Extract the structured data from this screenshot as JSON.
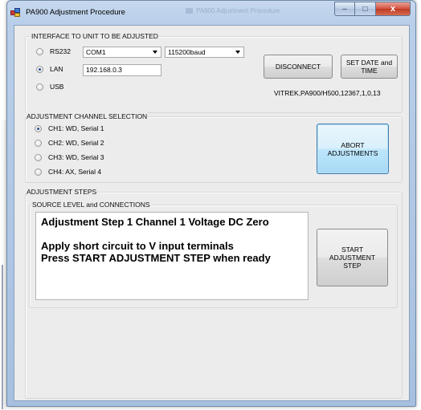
{
  "window": {
    "title": "PA900 Adjustment Procedure",
    "ghost_title": "PA900 Adjustment Procedure",
    "controls": {
      "minimize": "–",
      "maximize": "□",
      "close": "x"
    }
  },
  "interface_group": {
    "legend": "INTERFACE TO UNIT TO BE ADJUSTED",
    "options": [
      {
        "label": "RS232",
        "checked": false
      },
      {
        "label": "LAN",
        "checked": true
      },
      {
        "label": "USB",
        "checked": false
      }
    ],
    "com_port": {
      "value": "COM1"
    },
    "baud_rate": {
      "value": "115200baud"
    },
    "ip_address": {
      "value": "192.168.0.3"
    },
    "disconnect_label": "DISCONNECT",
    "set_date_label_line1": "SET DATE and",
    "set_date_label_line2": "TIME",
    "device_id": "VITREK,PA900/H500,12367,1,0,13"
  },
  "channel_group": {
    "legend": "ADJUSTMENT CHANNEL SELECTION",
    "channels": [
      {
        "label": "CH1: WD, Serial 1",
        "checked": true
      },
      {
        "label": "CH2: WD, Serial 2",
        "checked": false
      },
      {
        "label": "CH3: WD, Serial 3",
        "checked": false
      },
      {
        "label": "CH4: AX, Serial 4",
        "checked": false
      }
    ],
    "abort_label_line1": "ABORT",
    "abort_label_line2": "ADJUSTMENTS"
  },
  "steps_group": {
    "legend": "ADJUSTMENT STEPS",
    "source_legend": "SOURCE LEVEL and CONNECTIONS",
    "message_lines": [
      "Adjustment Step 1 Channel 1 Voltage DC Zero",
      "",
      "Apply short circuit to V input terminals",
      "Press START ADJUSTMENT STEP when ready"
    ],
    "start_label_line1": "START",
    "start_label_line2": "ADJUSTMENT",
    "start_label_line3": "STEP"
  },
  "colors": {
    "title_bar": "#b9cfe9",
    "client_bg": "#ececec",
    "close_button": "#c13a23",
    "focused_button": "#3c7fb1"
  }
}
